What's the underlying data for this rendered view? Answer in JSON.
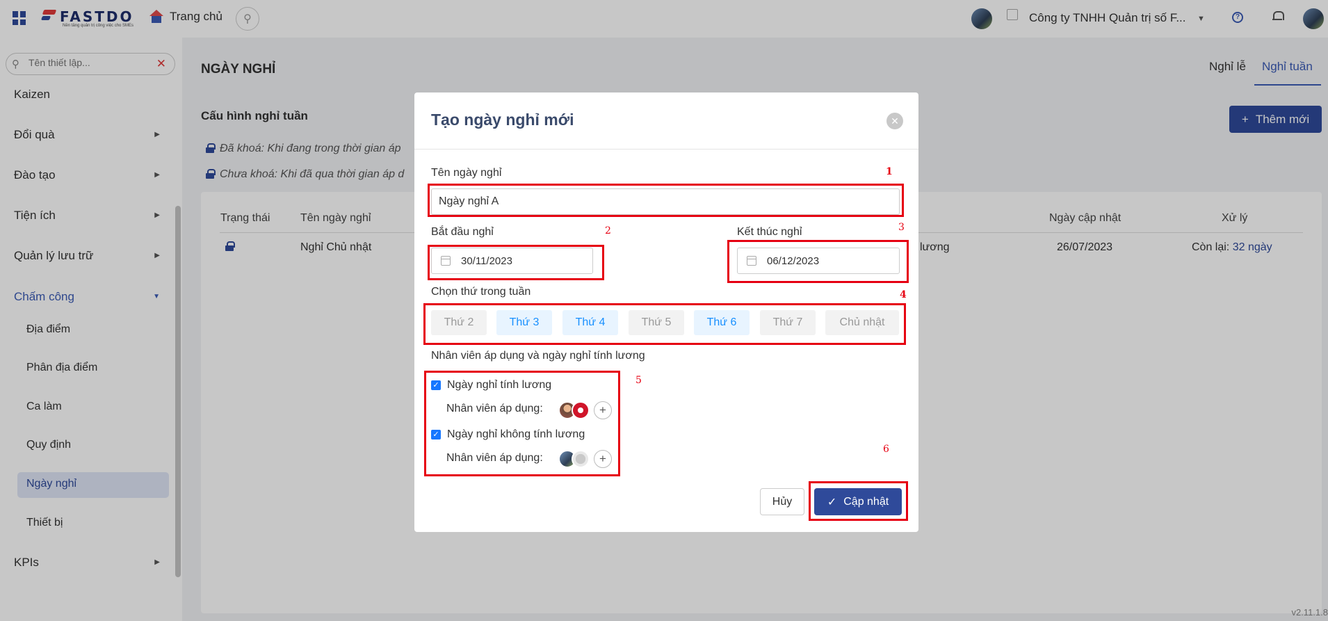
{
  "topbar": {
    "logo_text": "FASTDO",
    "logo_sub": "Nền tảng quản trị công việc cho SMEs",
    "home_label": "Trang chủ",
    "company_name": "Công ty TNHH Quản trị số F...",
    "help_glyph": "?",
    "accent": "#2f4a9a"
  },
  "sidebar": {
    "search_placeholder": "Tên thiết lập...",
    "clear_glyph": "✕",
    "items": [
      {
        "label": "Kaizen"
      },
      {
        "label": "Đổi quà"
      },
      {
        "label": "Đào tạo"
      },
      {
        "label": "Tiện ích"
      },
      {
        "label": "Quản lý lưu trữ"
      },
      {
        "label": "Chấm công"
      },
      {
        "label": "KPIs"
      }
    ],
    "sub_items": [
      {
        "label": "Địa điểm"
      },
      {
        "label": "Phân địa điểm"
      },
      {
        "label": "Ca làm"
      },
      {
        "label": "Quy định"
      },
      {
        "label": "Ngày nghỉ"
      },
      {
        "label": "Thiết bị"
      }
    ],
    "active_sub": "Ngày nghỉ"
  },
  "page": {
    "title": "NGÀY NGHỈ",
    "tabs": [
      {
        "label": "Nghỉ lễ"
      },
      {
        "label": "Nghỉ tuần"
      }
    ],
    "active_tab": "Nghỉ tuần",
    "section_title": "Cấu hình nghỉ tuần",
    "add_button": "Thêm mới",
    "note_locked": "Đã khoá: Khi đang trong thời gian áp",
    "note_unlocked": "Chưa khoá: Khi đã qua thời gian áp d"
  },
  "table": {
    "headers": {
      "status": "Trạng thái",
      "name": "Tên ngày nghỉ",
      "updated": "Ngày cập nhật",
      "action": "Xử lý"
    },
    "rows": [
      {
        "name": "Nghỉ Chủ nhật",
        "partial": "lương",
        "updated": "26/07/2023",
        "remaining_label": "Còn lại:",
        "remaining_value": "32 ngày"
      }
    ]
  },
  "version": "v2.11.1.8",
  "modal": {
    "title": "Tạo ngày nghỉ mới",
    "close_glyph": "✕",
    "name_label": "Tên ngày nghỉ",
    "name_value": "Ngày nghỉ A",
    "start_label": "Bắt đầu nghỉ",
    "start_value": "30/11/2023",
    "end_label": "Kết thúc nghỉ",
    "end_value": "06/12/2023",
    "weekday_label": "Chọn thứ trong tuần",
    "weekdays": [
      {
        "label": "Thứ 2",
        "selected": false
      },
      {
        "label": "Thứ 3",
        "selected": true
      },
      {
        "label": "Thứ 4",
        "selected": true
      },
      {
        "label": "Thứ 5",
        "selected": false
      },
      {
        "label": "Thứ 6",
        "selected": true
      },
      {
        "label": "Thứ 7",
        "selected": false
      },
      {
        "label": "Chủ nhật",
        "selected": false
      }
    ],
    "staff_section_label": "Nhân viên áp dụng và ngày nghỉ tính lương",
    "paid_label": "Ngày nghỉ tính lương",
    "paid_checked": true,
    "unpaid_label": "Ngày nghỉ không tính lương",
    "unpaid_checked": true,
    "staff_label": "Nhân viên áp dụng:",
    "add_glyph": "+",
    "check_glyph": "✓",
    "cancel_button": "Hủy",
    "save_button": "Cập nhật"
  },
  "annotations": [
    "1",
    "2",
    "3",
    "4",
    "5",
    "6"
  ]
}
